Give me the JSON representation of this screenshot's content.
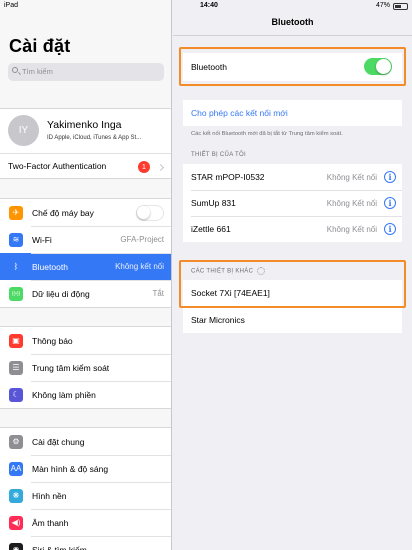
{
  "status_bar": {
    "device": "iPad",
    "time": "14:40",
    "battery": "47%",
    "battery_level": 0.47
  },
  "sidebar": {
    "title": "Cài đặt",
    "search_placeholder": "Tìm kiếm",
    "profile": {
      "initials": "IY",
      "name": "Yakimenko Inga",
      "subtitle": "ID Apple, iCloud, iTunes & App St..."
    },
    "two_factor": {
      "label": "Two-Factor Authentication",
      "badge": "1"
    },
    "group1": [
      {
        "label": "Chế độ máy bay",
        "icon": "airplane-icon",
        "color": "#ff9500",
        "glyph": "✈",
        "toggle": false
      },
      {
        "label": "Wi-Fi",
        "icon": "wifi-icon",
        "color": "#3478f6",
        "glyph": "≋",
        "value": "GFA-Project"
      },
      {
        "label": "Bluetooth",
        "icon": "bluetooth-icon",
        "color": "#3478f6",
        "glyph": "ᛒ",
        "value": "Không kết nối",
        "selected": true
      },
      {
        "label": "Dữ liệu di động",
        "icon": "cellular-icon",
        "color": "#4cd964",
        "glyph": "((•))",
        "value": "Tắt"
      }
    ],
    "group2": [
      {
        "label": "Thông báo",
        "icon": "notifications-icon",
        "color": "#ff3b30",
        "glyph": "▣"
      },
      {
        "label": "Trung tâm kiểm soát",
        "icon": "control-center-icon",
        "color": "#8e8e93",
        "glyph": "☰"
      },
      {
        "label": "Không làm phiền",
        "icon": "moon-icon",
        "color": "#5856d6",
        "glyph": "☾"
      }
    ],
    "group3": [
      {
        "label": "Cài đặt chung",
        "icon": "gear-icon",
        "color": "#8e8e93",
        "glyph": "⚙"
      },
      {
        "label": "Màn hình & độ sáng",
        "icon": "display-icon",
        "color": "#3478f6",
        "glyph": "AA"
      },
      {
        "label": "Hình nền",
        "icon": "wallpaper-icon",
        "color": "#34aadc",
        "glyph": "❋"
      },
      {
        "label": "Âm thanh",
        "icon": "sound-icon",
        "color": "#ff2d55",
        "glyph": "◀)"
      },
      {
        "label": "Siri & tìm kiếm",
        "icon": "siri-icon",
        "color": "#1c1c1e",
        "glyph": "◉"
      }
    ]
  },
  "main": {
    "nav_title": "Bluetooth",
    "bluetooth_toggle_label": "Bluetooth",
    "bluetooth_on": true,
    "allow_new_connections": "Cho phép các kết nối mới",
    "allow_footnote": "Các kết nối Bluetooth mới đã bị tắt từ Trung tâm kiểm soát.",
    "my_devices_header": "THIẾT BỊ CỦA TÔI",
    "my_devices": [
      {
        "name": "STAR mPOP-I0532",
        "status": "Không Kết nối"
      },
      {
        "name": "SumUp 831",
        "status": "Không Kết nối"
      },
      {
        "name": "iZettle 661",
        "status": "Không Kết nối"
      }
    ],
    "other_devices_header": "CÁC THIẾT BỊ KHÁC",
    "other_devices": [
      {
        "name": "Socket 7Xi [74EAE1]"
      },
      {
        "name": "Star Micronics"
      }
    ]
  },
  "colors": {
    "accent": "#3478f6",
    "highlight_box": "#f28c28",
    "toggle_on": "#4cd964"
  }
}
